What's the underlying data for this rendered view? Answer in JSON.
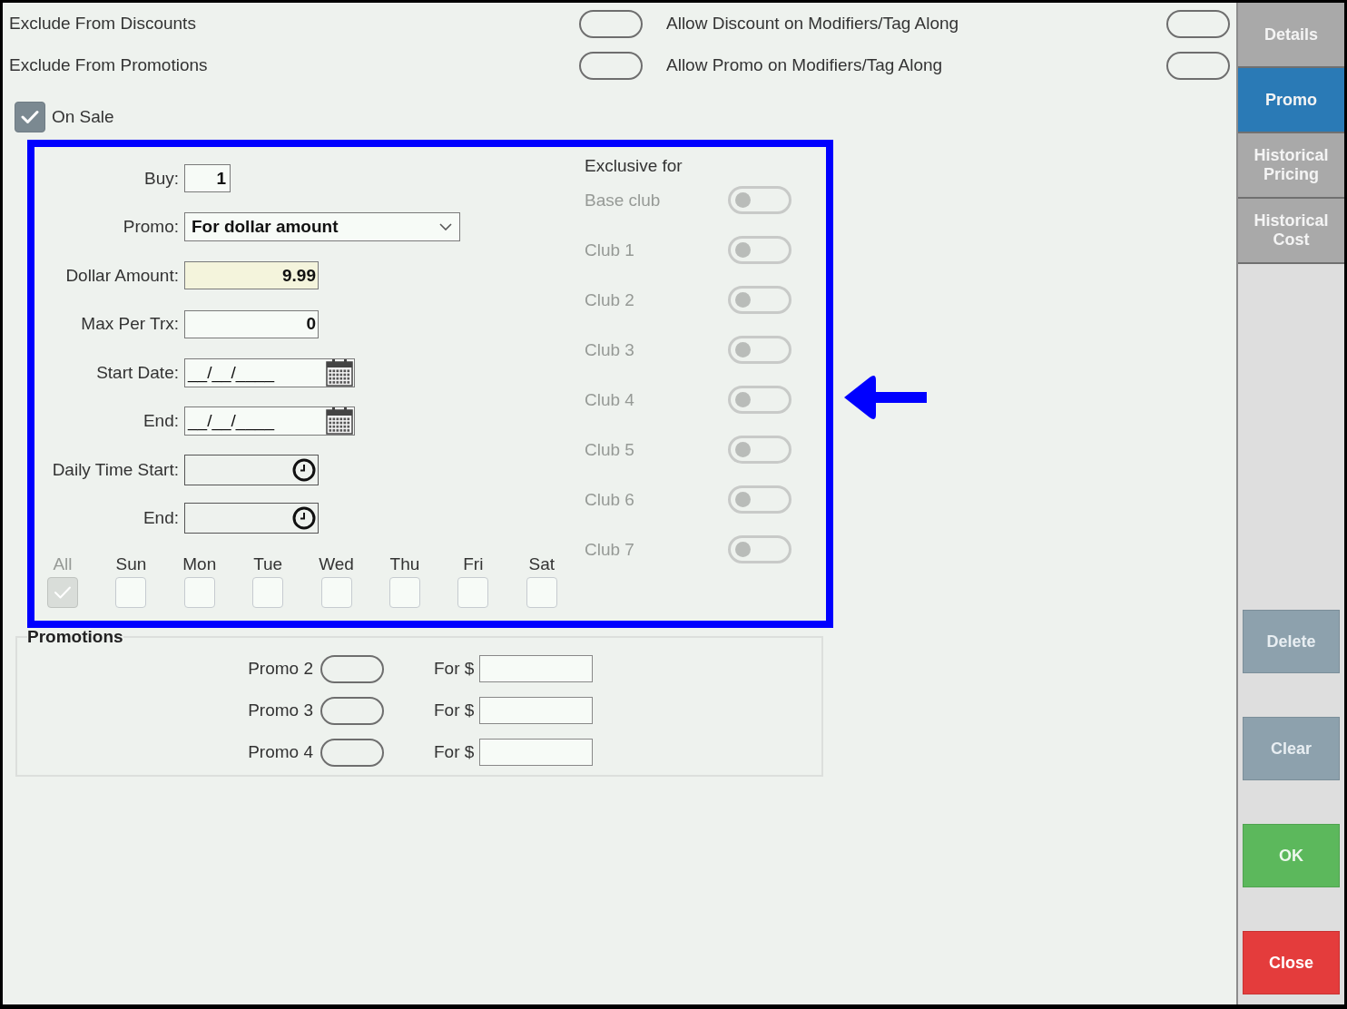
{
  "options": [
    {
      "label": "Exclude From Discounts",
      "on": false
    },
    {
      "label": "Allow Discount on Modifiers/Tag Along",
      "on": false
    },
    {
      "label": "Exclude From Promotions",
      "on": false
    },
    {
      "label": "Allow Promo on Modifiers/Tag Along",
      "on": false
    }
  ],
  "on_sale": {
    "label": "On Sale",
    "checked": true
  },
  "promo_form": {
    "fields": [
      {
        "label": "Buy:",
        "kind": "short",
        "value": "1",
        "highlighted": false
      },
      {
        "label": "Promo:",
        "kind": "select",
        "value": "For dollar amount",
        "highlighted": false
      },
      {
        "label": "Dollar Amount:",
        "kind": "number",
        "value": "9.99",
        "highlighted": true
      },
      {
        "label": "Max Per Trx:",
        "kind": "number",
        "value": "0",
        "highlighted": false
      },
      {
        "label": "Start Date:",
        "kind": "date",
        "value": "__/__/____",
        "highlighted": false
      },
      {
        "label": "End:",
        "kind": "date",
        "value": "__/__/____",
        "highlighted": false
      },
      {
        "label": "Daily Time Start:",
        "kind": "time",
        "highlighted": false
      },
      {
        "label": "End:",
        "kind": "time",
        "highlighted": false
      }
    ],
    "days": [
      {
        "label": "All",
        "checked": true,
        "disabled": true
      },
      {
        "label": "Sun",
        "checked": false,
        "disabled": false
      },
      {
        "label": "Mon",
        "checked": false,
        "disabled": false
      },
      {
        "label": "Tue",
        "checked": false,
        "disabled": false
      },
      {
        "label": "Wed",
        "checked": false,
        "disabled": false
      },
      {
        "label": "Thu",
        "checked": false,
        "disabled": false
      },
      {
        "label": "Fri",
        "checked": false,
        "disabled": false
      },
      {
        "label": "Sat",
        "checked": false,
        "disabled": false
      }
    ],
    "exclusive": {
      "title": "Exclusive for",
      "clubs": [
        {
          "label": "Base club",
          "on": false,
          "disabled": true
        },
        {
          "label": "Club 1",
          "on": false,
          "disabled": true
        },
        {
          "label": "Club 2",
          "on": false,
          "disabled": true
        },
        {
          "label": "Club 3",
          "on": false,
          "disabled": true
        },
        {
          "label": "Club 4",
          "on": false,
          "disabled": true
        },
        {
          "label": "Club 5",
          "on": false,
          "disabled": true
        },
        {
          "label": "Club 6",
          "on": false,
          "disabled": true
        },
        {
          "label": "Club 7",
          "on": false,
          "disabled": true
        }
      ]
    }
  },
  "promotions": {
    "title": "Promotions",
    "rows": [
      {
        "label": "Promo 2",
        "on": false,
        "price_label": "For $"
      },
      {
        "label": "Promo 3",
        "on": false,
        "price_label": "For $"
      },
      {
        "label": "Promo 4",
        "on": false,
        "price_label": "For $"
      }
    ]
  },
  "tabs": [
    {
      "label": "Details",
      "selected": false
    },
    {
      "label": "Promo",
      "selected": true
    },
    {
      "label": "Historical Pricing",
      "selected": false
    },
    {
      "label": "Historical Cost",
      "selected": false
    }
  ],
  "buttons": [
    {
      "label": "Delete",
      "kind": "delete"
    },
    {
      "label": "Clear",
      "kind": "clear"
    },
    {
      "label": "OK",
      "kind": "ok"
    },
    {
      "label": "Close",
      "kind": "close"
    }
  ]
}
